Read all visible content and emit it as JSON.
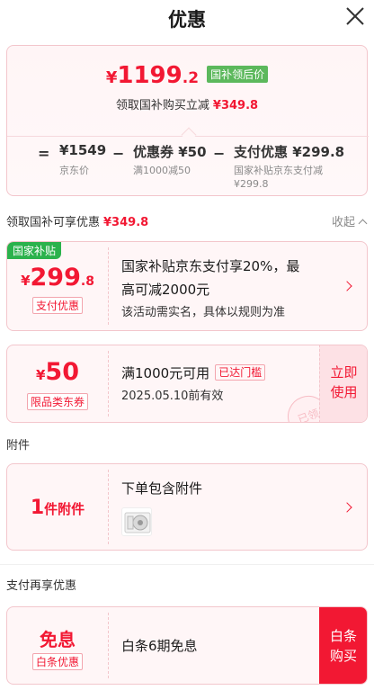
{
  "header": {
    "title": "优惠"
  },
  "summary": {
    "final_yen": "¥",
    "final_int": "1199",
    "final_dec": ".2",
    "final_tag": "国补领后价",
    "sub_label": "领取国补购买立减",
    "sub_amount": "¥349.8",
    "calc": {
      "eq": "=",
      "op1": "−",
      "op2": "−",
      "v1": "¥1549",
      "l1": "京东价",
      "v2": "优惠券 ¥50",
      "l2": "满1000减50",
      "v3": "支付优惠 ¥299.8",
      "l3a": "国家补贴京东支付减",
      "l3b": "¥299.8"
    }
  },
  "section_subsidy": {
    "title": "领取国补可享优惠",
    "amount": "¥349.8",
    "collapse": "收起"
  },
  "card_subsidy": {
    "corner": "国家补贴",
    "yen": "¥",
    "int": "299",
    "dec": ".8",
    "badge": "支付优惠",
    "line1": "国家补贴京东支付享20%，最",
    "line2": "高可减2000元",
    "line3": "该活动需实名，具体以规则为准"
  },
  "card_coupon": {
    "yen": "¥",
    "int": "50",
    "badge": "限品类东券",
    "line1": "满1000元可用",
    "reached": "已达门槛",
    "line2": "2025.05.10前有效",
    "cta": "立即使用",
    "stamp": "已领"
  },
  "section_accessory": {
    "title": "附件"
  },
  "card_accessory": {
    "count": "1",
    "unit": "件附件",
    "line1": "下单包含附件"
  },
  "section_payment": {
    "title": "支付再享优惠"
  },
  "card_payment": {
    "title": "免息",
    "badge": "白条优惠",
    "line1": "白条6期免息",
    "cta": "白条购买"
  }
}
